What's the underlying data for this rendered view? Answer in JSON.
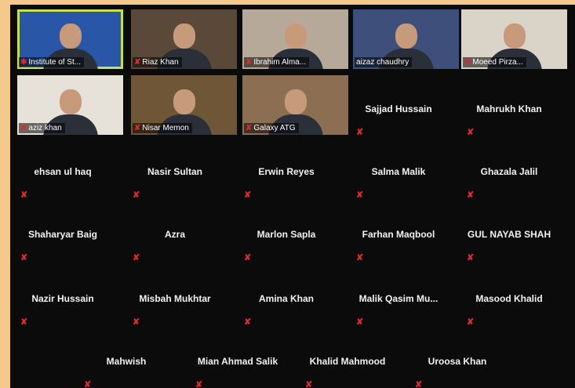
{
  "video_tiles": [
    {
      "label": "Institute of St...",
      "mic": "pin-icon",
      "active": true,
      "bg": "#2a56a8"
    },
    {
      "label": "Riaz Khan",
      "mic": "muted-mic-icon",
      "active": false,
      "bg": "#5a4838"
    },
    {
      "label": "Ibrahim Alma...",
      "mic": "muted-mic-icon",
      "active": false,
      "bg": "#b7a99a"
    },
    {
      "label": "aizaz chaudhry",
      "mic": "",
      "active": false,
      "bg": "#3d4f7a"
    },
    {
      "label": "Moeed Pirza...",
      "mic": "muted-mic-icon",
      "active": false,
      "bg": "#d9d3c8"
    },
    {
      "label": "aziz khan",
      "mic": "muted-mic-icon",
      "active": false,
      "bg": "#e6e2da"
    },
    {
      "label": "Nisar Memon",
      "mic": "muted-mic-icon",
      "active": false,
      "bg": "#6f5637"
    },
    {
      "label": "Galaxy ATG",
      "mic": "muted-mic-icon",
      "active": false,
      "bg": "#8c6e52"
    }
  ],
  "participants": [
    "Sajjad Hussain",
    "Mahrukh Khan",
    "ehsan ul haq",
    "Nasir Sultan",
    "Erwin Reyes",
    "Salma Malik",
    "Ghazala Jalil",
    "Shaharyar Baig",
    "Azra",
    "Marlon Sapla",
    "Farhan Maqbool",
    "GUL NAYAB SHAH",
    "Nazir Hussain",
    "Misbah Mukhtar",
    "Amina Khan",
    "Malik Qasim Mu...",
    "Masood Khalid",
    "Mahwish",
    "Mian Ahmad Salik",
    "Khalid Mahmood",
    "Uroosa Khan"
  ],
  "colors": {
    "muted": "#e0282f",
    "active_border": "#c8e04a",
    "frame": "#f5c98c"
  }
}
